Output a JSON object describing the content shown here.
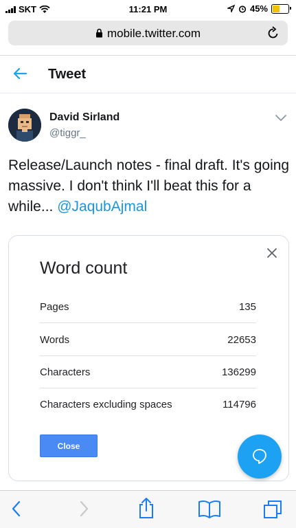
{
  "status_bar": {
    "carrier": "SKT",
    "time": "11:21 PM",
    "battery": "45%",
    "battery_level": 0.45
  },
  "browser": {
    "url": "mobile.twitter.com"
  },
  "header": {
    "title": "Tweet"
  },
  "tweet": {
    "author_name": "David Sirland",
    "author_handle": "@tiggr_",
    "text": "Release/Launch notes - final draft. It's going massive. I don't think I'll beat this for a while... ",
    "mention": "@JaqubAjmal"
  },
  "word_count": {
    "title": "Word count",
    "rows": [
      {
        "label": "Pages",
        "value": "135"
      },
      {
        "label": "Words",
        "value": "22653"
      },
      {
        "label": "Characters",
        "value": "136299"
      },
      {
        "label": "Characters excluding spaces",
        "value": "114796"
      }
    ],
    "close_label": "Close"
  },
  "colors": {
    "twitter_blue": "#1da1f2",
    "mention": "#1b95e0",
    "docs_button": "#4a8af4"
  },
  "icons": [
    "signal-icon",
    "wifi-icon",
    "location-icon",
    "alarm-icon",
    "battery-icon",
    "lock-icon",
    "reload-icon",
    "back-arrow-icon",
    "chevron-down-icon",
    "close-icon",
    "compose-reply-icon",
    "browser-back-icon",
    "browser-forward-icon",
    "share-icon",
    "bookmarks-icon",
    "tabs-icon"
  ]
}
